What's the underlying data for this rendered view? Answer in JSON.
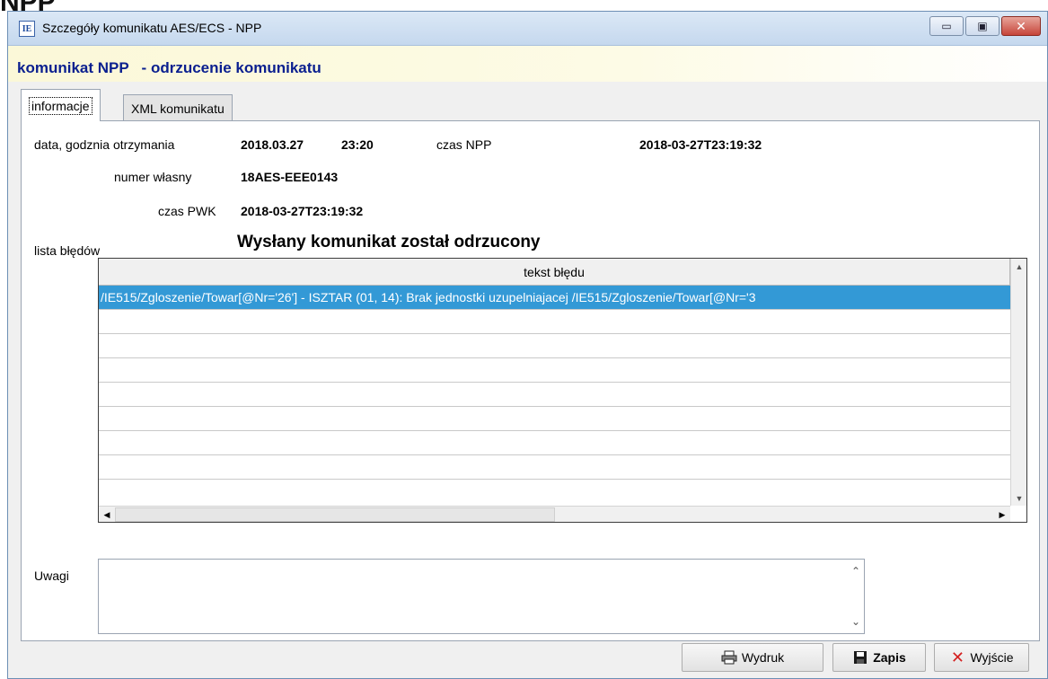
{
  "background": {
    "fragment": "NPP"
  },
  "window": {
    "title": "Szczegóły komunikatu AES/ECS - NPP",
    "app_icon_label": "IE",
    "controls": {
      "minimize": "▭",
      "restore": "▣",
      "close": "✕"
    }
  },
  "header": {
    "title": "komunikat NPP   - odrzucenie komunikatu"
  },
  "tabs": [
    {
      "label": "informacje",
      "active": true
    },
    {
      "label": "XML komunikatu",
      "active": false
    }
  ],
  "info": {
    "received_label": "data, godznia otrzymania",
    "received_date": "2018.03.27",
    "received_time": "23:20",
    "npp_time_label": "czas NPP",
    "npp_time_value": "2018-03-27T23:19:32",
    "own_number_label": "numer własny",
    "own_number_value": "18AES-EEE0143",
    "pwk_time_label": "czas PWK",
    "pwk_time_value": "2018-03-27T23:19:32",
    "status_message": "Wysłany komunikat został odrzucony"
  },
  "errors": {
    "label": "lista błędów",
    "column_header": "tekst błędu",
    "rows": [
      "/IE515/Zgloszenie/Towar[@Nr='26'] - ISZTAR (01, 14): Brak jednostki uzupelniajacej /IE515/Zgloszenie/Towar[@Nr='3",
      "",
      "",
      "",
      "",
      "",
      "",
      "",
      ""
    ]
  },
  "notes": {
    "label": "Uwagi",
    "value": ""
  },
  "buttons": {
    "print": {
      "label": "Wydruk",
      "icon": "printer-icon"
    },
    "save": {
      "label": "Zapis",
      "icon": "floppy-icon"
    },
    "exit": {
      "label": "Wyjście",
      "icon": "close-x-icon"
    }
  },
  "colors": {
    "header_text": "#0a1f8f",
    "selection": "#3399d6",
    "exit_icon": "#d42020"
  }
}
